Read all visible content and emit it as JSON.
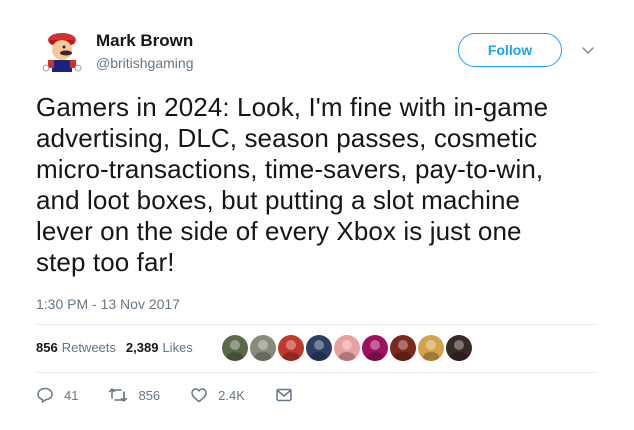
{
  "user": {
    "display_name": "Mark Brown",
    "handle": "@britishgaming"
  },
  "follow_label": "Follow",
  "tweet": {
    "text": "Gamers in 2024: Look, I'm fine with in-game\nadvertising, DLC, season passes, cosmetic\nmicro-transactions, time-savers, pay-to-win,\nand loot boxes, but putting a slot machine\nlever on the side of every Xbox is just one\nstep too far!",
    "timestamp": "1:30 PM - 13 Nov 2017"
  },
  "stats": {
    "retweets_count": "856",
    "retweets_label": "Retweets",
    "likes_count": "2,389",
    "likes_label": "Likes"
  },
  "likers": [
    {
      "icon": "liker-avatar",
      "color": "#5b6b4a"
    },
    {
      "icon": "liker-avatar",
      "color": "#8a8a7a"
    },
    {
      "icon": "liker-avatar",
      "color": "#c0392b"
    },
    {
      "icon": "liker-avatar",
      "color": "#2c3e66"
    },
    {
      "icon": "liker-avatar",
      "color": "#e8a0a0"
    },
    {
      "icon": "liker-avatar",
      "color": "#a01060"
    },
    {
      "icon": "liker-avatar",
      "color": "#7a2a1a"
    },
    {
      "icon": "liker-avatar",
      "color": "#d4a24a"
    },
    {
      "icon": "liker-avatar",
      "color": "#3a2a24"
    }
  ],
  "actions": {
    "replies": "41",
    "retweets": "856",
    "likes": "2.4K"
  },
  "colors": {
    "accent": "#1da1f2",
    "text": "#14171a",
    "muted": "#657786"
  }
}
